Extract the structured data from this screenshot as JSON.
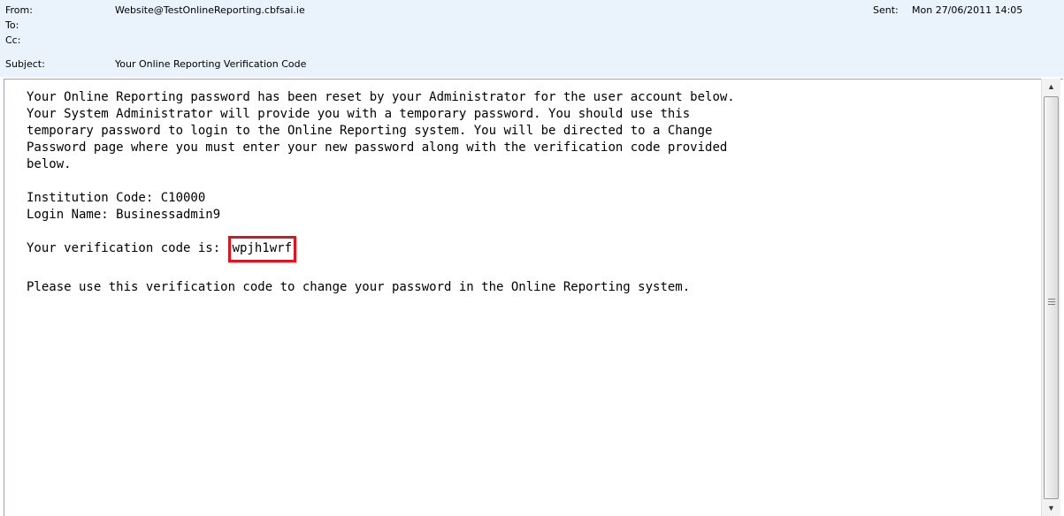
{
  "header": {
    "from_label": "From:",
    "from_value": "Website@TestOnlineReporting.cbfsai.ie",
    "to_label": "To:",
    "to_value": "",
    "cc_label": "Cc:",
    "cc_value": "",
    "subject_label": "Subject:",
    "subject_value": "Your Online Reporting Verification Code",
    "sent_label": "Sent:",
    "sent_value": "Mon 27/06/2011 14:05"
  },
  "body": {
    "paragraph1": "Your Online Reporting password has been reset by your Administrator for the user account below.\nYour System Administrator will provide you with a temporary password. You should use this\ntemporary password to login to the Online Reporting system. You will be directed to a Change\nPassword page where you must enter your new password along with the verification code provided\nbelow.",
    "institution_line": "Institution Code: C10000",
    "login_line": "Login Name: Businessadmin9",
    "verification_prefix": "Your verification code is: ",
    "verification_code": "wpjh1wrf",
    "closing_line": "Please use this verification code to change your password in the Online Reporting system."
  },
  "scrollbar": {
    "up_icon": "▲",
    "down_icon": "▼"
  },
  "colors": {
    "header_bg": "#eaf2fb",
    "highlight_border": "#e0141e"
  }
}
